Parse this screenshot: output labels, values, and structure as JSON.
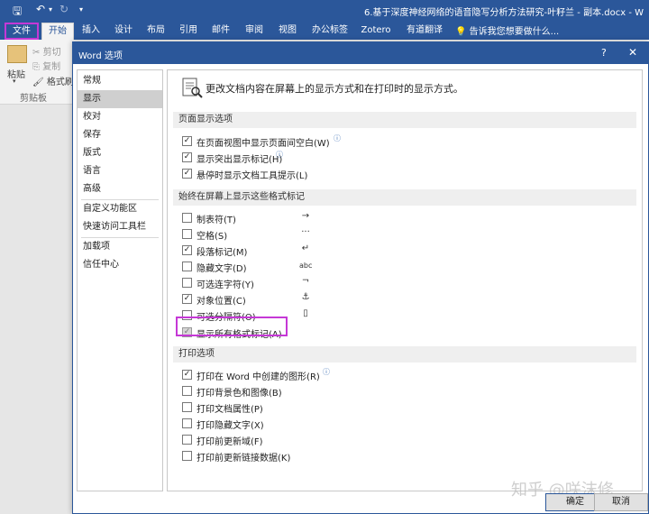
{
  "titlebar": {
    "doc_title": "6.基于深度神经网络的语音隐写分析方法研究-叶籽兰 - 副本.docx - W"
  },
  "tabs": [
    {
      "label": "文件"
    },
    {
      "label": "开始"
    },
    {
      "label": "插入"
    },
    {
      "label": "设计"
    },
    {
      "label": "布局"
    },
    {
      "label": "引用"
    },
    {
      "label": "邮件"
    },
    {
      "label": "审阅"
    },
    {
      "label": "视图"
    },
    {
      "label": "办公标签"
    },
    {
      "label": "Zotero"
    },
    {
      "label": "有道翻译"
    }
  ],
  "tell_me": "告诉我您想要做什么...",
  "ribbon": {
    "cut": "剪切",
    "copy": "复制",
    "paste": "粘贴",
    "format_painter": "格式刷",
    "clipboard_group": "剪贴板"
  },
  "dialog": {
    "title": "Word 选项",
    "help": "?",
    "close": "✕",
    "categories": [
      "常规",
      "显示",
      "校对",
      "保存",
      "版式",
      "语言",
      "高级",
      "自定义功能区",
      "快速访问工具栏",
      "加载项",
      "信任中心"
    ],
    "active_category": "显示",
    "intro": "更改文档内容在屏幕上的显示方式和在打印时的显示方式。",
    "sections": [
      {
        "title": "页面显示选项",
        "options": [
          {
            "label": "在页面视图中显示页面间空白(W)",
            "checked": true,
            "info": true
          },
          {
            "label": "显示突出显示标记(H)",
            "checked": true,
            "info": true
          },
          {
            "label": "悬停时显示文档工具提示(L)",
            "checked": true,
            "info": false
          }
        ]
      },
      {
        "title": "始终在屏幕上显示这些格式标记",
        "options": [
          {
            "label": "制表符(T)",
            "checked": false,
            "symbol": "→"
          },
          {
            "label": "空格(S)",
            "checked": false,
            "symbol": "···"
          },
          {
            "label": "段落标记(M)",
            "checked": true,
            "symbol": "↵"
          },
          {
            "label": "隐藏文字(D)",
            "checked": false,
            "symbol": "abc"
          },
          {
            "label": "可选连字符(Y)",
            "checked": false,
            "symbol": "¬"
          },
          {
            "label": "对象位置(C)",
            "checked": true,
            "symbol": "⚓"
          },
          {
            "label": "可选分隔符(O)",
            "checked": false,
            "symbol": "▯"
          },
          {
            "label": "显示所有格式标记(A)",
            "checked": true,
            "grayed": true
          }
        ]
      },
      {
        "title": "打印选项",
        "options": [
          {
            "label": "打印在 Word 中创建的图形(R)",
            "checked": true,
            "info": true
          },
          {
            "label": "打印背景色和图像(B)",
            "checked": false
          },
          {
            "label": "打印文档属性(P)",
            "checked": false
          },
          {
            "label": "打印隐藏文字(X)",
            "checked": false
          },
          {
            "label": "打印前更新域(F)",
            "checked": false
          },
          {
            "label": "打印前更新链接数据(K)",
            "checked": false
          }
        ]
      }
    ],
    "ok": "确定",
    "cancel": "取消"
  },
  "watermark": "知乎 @咲沫修",
  "colors": {
    "accent": "#2b579a",
    "highlight": "#c538d6"
  }
}
